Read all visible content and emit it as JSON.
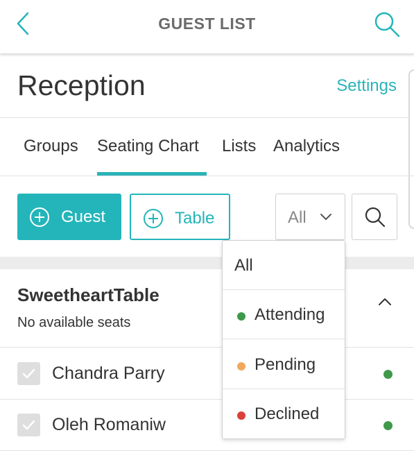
{
  "header": {
    "title": "GUEST LIST",
    "back_icon": "chevron-left-icon",
    "search_icon": "search-icon"
  },
  "event": {
    "name": "Reception",
    "settings_label": "Settings"
  },
  "tabs": [
    {
      "label": "Groups",
      "active": false
    },
    {
      "label": "Seating Chart",
      "active": true
    },
    {
      "label": "Lists",
      "active": false
    },
    {
      "label": "Analytics",
      "active": false
    }
  ],
  "toolbar": {
    "add_guest_label": "Guest",
    "add_table_label": "Table",
    "filter_value": "All"
  },
  "filter_menu": {
    "options": [
      {
        "label": "All",
        "color": ""
      },
      {
        "label": "Attending",
        "color": "#3e9a4a"
      },
      {
        "label": "Pending",
        "color": "#f0a95c"
      },
      {
        "label": "Declined",
        "color": "#d9413a"
      }
    ]
  },
  "seating_table": {
    "name": "SweetheartTable",
    "subtitle": "No available seats",
    "guests": [
      {
        "name": "Chandra Parry",
        "status_color": "#3e9a4a",
        "checked": true
      },
      {
        "name": "Oleh Romaniw",
        "status_color": "#3e9a4a",
        "checked": true
      }
    ]
  },
  "colors": {
    "accent": "#23b5ba",
    "attending": "#3e9a4a",
    "pending": "#f0a95c",
    "declined": "#d9413a"
  }
}
